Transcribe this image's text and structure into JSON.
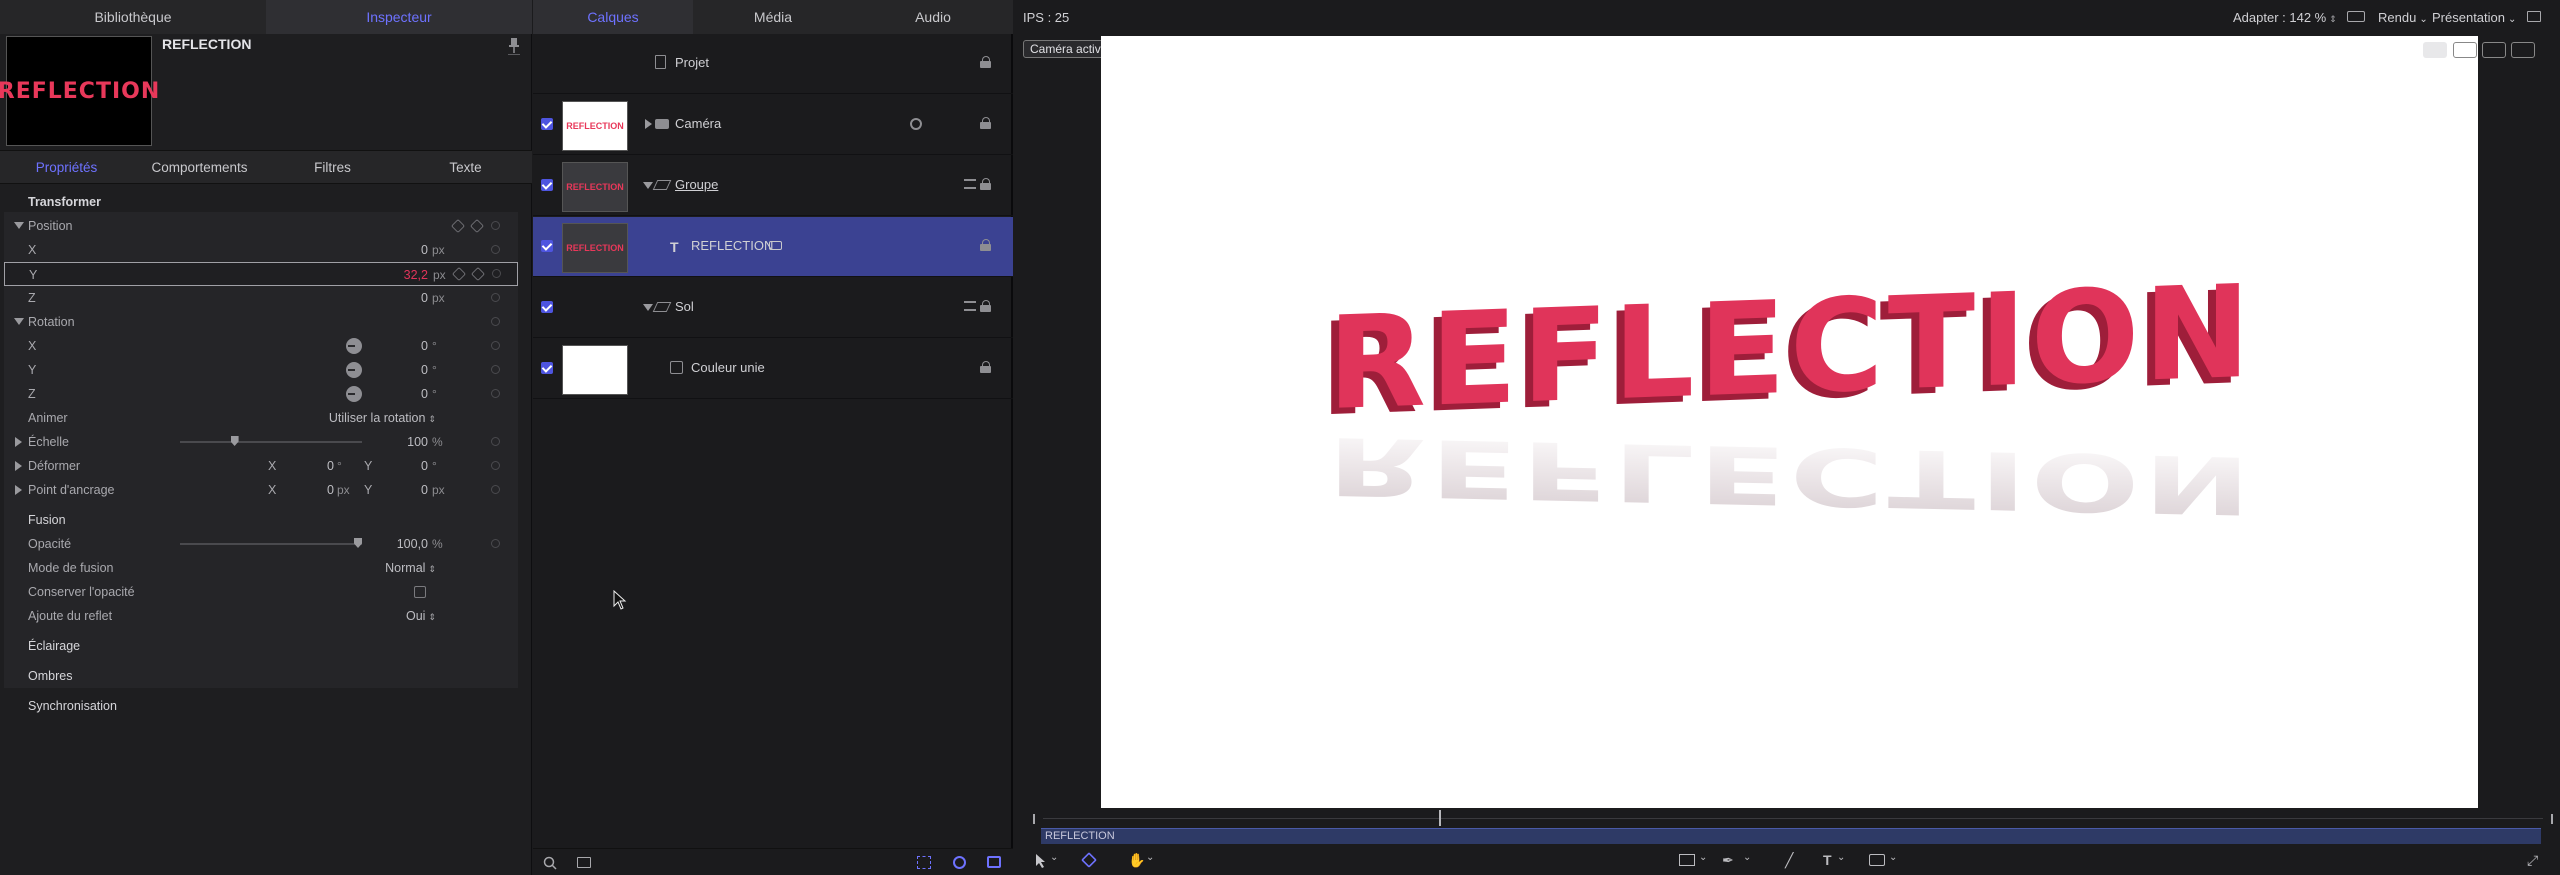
{
  "left_panel": {
    "tabs": [
      "Bibliothèque",
      "Inspecteur"
    ],
    "active_tab": "Inspecteur",
    "preview_text": "REFLECTION",
    "item_name": "REFLECTION",
    "subtabs": [
      "Propriétés",
      "Comportements",
      "Filtres",
      "Texte"
    ],
    "active_subtab": "Propriétés",
    "transform": {
      "title": "Transformer",
      "position_label": "Position",
      "x_label": "X",
      "x_value": "0",
      "x_unit": "px",
      "y_label": "Y",
      "y_value": "32,2",
      "y_unit": "px",
      "z_label": "Z",
      "z_value": "0",
      "z_unit": "px",
      "rotation_label": "Rotation",
      "rx_label": "X",
      "rx_value": "0",
      "rx_unit": "°",
      "ry_label": "Y",
      "ry_value": "0",
      "ry_unit": "°",
      "rz_label": "Z",
      "rz_value": "0",
      "rz_unit": "°",
      "animate_label": "Animer",
      "animate_value": "Utiliser la rotation",
      "scale_label": "Échelle",
      "scale_value": "100",
      "scale_unit": "%",
      "scale_fraction": 0.3,
      "shear_label": "Déformer",
      "shear_x_label": "X",
      "shear_x_value": "0",
      "shear_x_unit": "°",
      "shear_y_label": "Y",
      "shear_y_value": "0",
      "shear_y_unit": "°",
      "anchor_label": "Point d'ancrage",
      "anchor_x_label": "X",
      "anchor_x_value": "0",
      "anchor_x_unit": "px",
      "anchor_y_label": "Y",
      "anchor_y_value": "0",
      "anchor_y_unit": "px"
    },
    "blend": {
      "title": "Fusion",
      "opacity_label": "Opacité",
      "opacity_value": "100,0",
      "opacity_unit": "%",
      "opacity_fraction": 1.0,
      "mode_label": "Mode de fusion",
      "mode_value": "Normal",
      "preserve_label": "Conserver l'opacité",
      "reflection_label": "Ajoute du reflet",
      "reflection_value": "Oui"
    },
    "sections": [
      "Éclairage",
      "Ombres",
      "Synchronisation"
    ]
  },
  "middle_panel": {
    "tabs": [
      "Calques",
      "Média",
      "Audio"
    ],
    "active_tab": "Calques",
    "layers": [
      {
        "name": "Projet",
        "thumb": ""
      },
      {
        "name": "Caméra",
        "thumb": "REFLECTION"
      },
      {
        "name": "Groupe",
        "thumb": "REFLECTION"
      },
      {
        "name": "REFLECTION",
        "thumb": "REFLECTION"
      },
      {
        "name": "Sol",
        "thumb": ""
      },
      {
        "name": "Couleur unie",
        "thumb": ""
      }
    ]
  },
  "right_panel": {
    "fps_label": "IPS : 25",
    "fit_label": "Adapter : 142 %",
    "render_label": "Rendu",
    "presentation_label": "Présentation",
    "camera_select": "Caméra active",
    "canvas_text": "REFLECTION",
    "timeline_label": "REFLECTION"
  },
  "colors": {
    "accent": "#6e72ff",
    "title_red": "#e0345a",
    "selection": "#3b4292"
  }
}
